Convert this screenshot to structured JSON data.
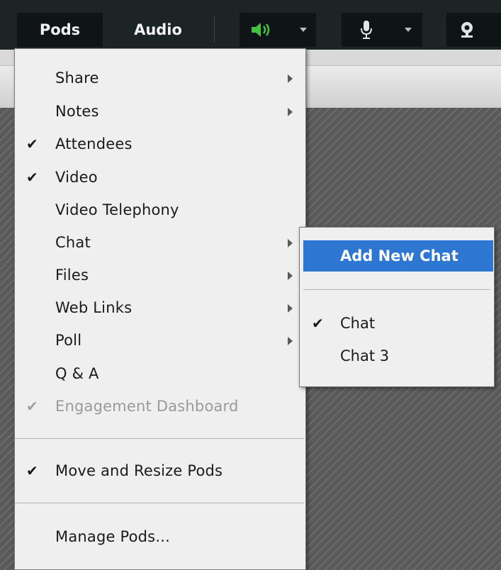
{
  "menubar": {
    "pods_label": "Pods",
    "audio_label": "Audio",
    "speaker_icon": "speaker-icon",
    "microphone_icon": "microphone-icon",
    "webcam_icon": "webcam-icon",
    "speaker_color": "#3ec43e"
  },
  "pods_menu": {
    "items": [
      {
        "label": "Share",
        "checked": false,
        "submenu": true,
        "disabled": false
      },
      {
        "label": "Notes",
        "checked": false,
        "submenu": true,
        "disabled": false
      },
      {
        "label": "Attendees",
        "checked": true,
        "submenu": false,
        "disabled": false
      },
      {
        "label": "Video",
        "checked": true,
        "submenu": false,
        "disabled": false
      },
      {
        "label": "Video Telephony",
        "checked": false,
        "submenu": false,
        "disabled": false
      },
      {
        "label": "Chat",
        "checked": false,
        "submenu": true,
        "disabled": false
      },
      {
        "label": "Files",
        "checked": false,
        "submenu": true,
        "disabled": false
      },
      {
        "label": "Web Links",
        "checked": false,
        "submenu": true,
        "disabled": false
      },
      {
        "label": "Poll",
        "checked": false,
        "submenu": true,
        "disabled": false
      },
      {
        "label": "Q & A",
        "checked": false,
        "submenu": false,
        "disabled": false
      },
      {
        "label": "Engagement Dashboard",
        "checked": true,
        "submenu": false,
        "disabled": true
      }
    ],
    "move_resize": {
      "label": "Move and Resize Pods",
      "checked": true
    },
    "manage": {
      "label": "Manage Pods..."
    }
  },
  "chat_submenu": {
    "add_new": "Add New Chat",
    "chats": [
      {
        "label": "Chat",
        "checked": true
      },
      {
        "label": "Chat 3",
        "checked": false
      }
    ],
    "highlight_color": "#2d77d2"
  },
  "check_glyph": "✔"
}
